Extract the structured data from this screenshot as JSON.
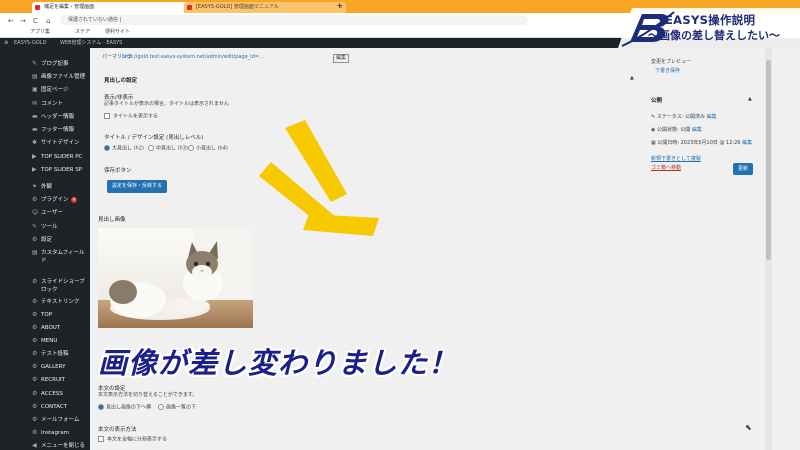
{
  "browser": {
    "tab1_title": "補足を編集 ‹ 管理画面",
    "tab2_title": "[EASYS-GOLD] 管理画面マニュアル",
    "new_tab": "+",
    "tab_close": "×",
    "url": "保護されていない通信 | ",
    "back": "←",
    "forward": "→",
    "reload": "C",
    "home": "⌂",
    "bookmarks": [
      "アプリ集",
      "ステア",
      "便利サイト"
    ]
  },
  "admin_bar": {
    "site": "EASYS-GOLD",
    "cms": "WEB管理システム - EASYS"
  },
  "sidebar": {
    "items": [
      {
        "icon": "✎",
        "label": "ブログ記事"
      },
      {
        "icon": "▤",
        "label": "画像ファイル管理"
      },
      {
        "icon": "▣",
        "label": "固定ページ"
      },
      {
        "icon": "✉",
        "label": "コメント"
      },
      {
        "icon": "▬",
        "label": "ヘッダー情報"
      },
      {
        "icon": "▬",
        "label": "フッター情報"
      },
      {
        "icon": "✱",
        "label": "サイトデザイン"
      },
      {
        "icon": "▶",
        "label": "TOP SLIDER PC"
      },
      {
        "icon": "▶",
        "label": "TOP SLIDER SP"
      },
      {
        "icon": "✦",
        "label": "外観"
      },
      {
        "icon": "⚙",
        "label": "プラグイン",
        "badge": "9"
      },
      {
        "icon": "☺",
        "label": "ユーザー"
      },
      {
        "icon": "✎",
        "label": "ツール"
      },
      {
        "icon": "⚙",
        "label": "設定"
      },
      {
        "icon": "▤",
        "label": "カスタムフィールド"
      },
      {
        "icon": "⚙",
        "label": "スライドショーブロック"
      },
      {
        "icon": "⚙",
        "label": "テキストリンク"
      },
      {
        "icon": "⚙",
        "label": "TOP"
      },
      {
        "icon": "⚙",
        "label": "ABOUT"
      },
      {
        "icon": "⚙",
        "label": "MENU"
      },
      {
        "icon": "⚙",
        "label": "テスト投稿"
      },
      {
        "icon": "⚙",
        "label": "GALLERY"
      },
      {
        "icon": "⚙",
        "label": "RECRUIT"
      },
      {
        "icon": "⚙",
        "label": "ACCESS"
      },
      {
        "icon": "⚙",
        "label": "CONTACT"
      },
      {
        "icon": "⚙",
        "label": "メールフォーム"
      },
      {
        "icon": "⚙",
        "label": "Instagram"
      },
      {
        "icon": "◀",
        "label": "メニューを閉じる"
      }
    ]
  },
  "editor": {
    "permalink_label": "パーマリンク:",
    "permalink_url": "http://gold.test.easys-system.net/admin/edit/page_id=...",
    "permalink_edit": "編集",
    "section_title": "見出しの設定",
    "display_label": "表示/非表示",
    "display_note": "記事タイトルが表示の場合、タイトルは表示されません",
    "display_checkbox": "タイトルを表示する",
    "level_label": "タイトル / デザイン設定 (見出しレベル)",
    "level_options": [
      "大見出し (h2)",
      "中見出し (h3)",
      "小見出し (h4)"
    ],
    "design_label": "保存ボタン",
    "apply_button": "設定を保存・反映する",
    "image_label": "見出し画像",
    "body_settings": "本文の設定",
    "body_note": "本文表示方法を切り替えることができます。",
    "body_options": [
      "見出し画像の下へ横",
      "画像一覧の下"
    ],
    "body_layout": "本文の表示方法",
    "body_layout_option": "本文を全幅に分割表示する"
  },
  "publish_box": {
    "preview_label": "変更をプレビュー",
    "preview_link": "下書き保存",
    "title": "公開",
    "status": "ステータス: 公開済み",
    "status_edit": "編集",
    "visibility": "公開状態: 公開",
    "visibility_edit": "編集",
    "published": "公開日時: 2023年5月10日 @ 12:26",
    "published_edit": "編集",
    "copy_link": "新規下書きとして複製",
    "trash_link": "ゴミ箱へ移動",
    "update_button": "更新",
    "collapse": "▲",
    "expand": "▼"
  },
  "overlay": {
    "title_line1": "EASYS操作説明",
    "title_line2": "〜画像の差し替えしたい〜",
    "caption": "画像が差し変わりました！",
    "accent_color": "#f7c900",
    "caption_color": "#1a1f8c"
  }
}
